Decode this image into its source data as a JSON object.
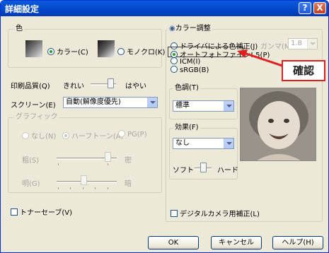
{
  "window": {
    "title": "詳細設定",
    "help_glyph": "?",
    "close_glyph": "X"
  },
  "color": {
    "group_label": "色",
    "option_color": "カラー(C)",
    "option_mono": "モノクロ(K)",
    "selected": "color"
  },
  "print_quality": {
    "label": "印刷品質(Q)",
    "left_label": "きれい",
    "right_label": "はやい"
  },
  "screen": {
    "label": "スクリーン(E)",
    "value": "自動(解像度優先)"
  },
  "graphic": {
    "group_label": "グラフィック",
    "options": [
      "なし(N)",
      "ハーフトーン(A)",
      "PG(P)"
    ],
    "selected": "ハーフトーン(A)",
    "coarse_label": "粗(S)",
    "coarse_right": "密",
    "bright_label": "明(G)",
    "bright_right": "暗"
  },
  "toner_save": {
    "label": "トナーセーブ(V)",
    "checked": false
  },
  "color_adjust": {
    "group_label": "カラー調整",
    "options": [
      "ドライバによる色補正(J)",
      "オートフォトファイン! 5(P)",
      "ICM(I)",
      "sRGB(B)"
    ],
    "selected": "オートフォトファイン! 5(P)",
    "gamma_label": "ガンマ(M)",
    "gamma_value": "1.8"
  },
  "tone": {
    "label": "色調(T)",
    "value": "標準"
  },
  "effect": {
    "label": "効果(F)",
    "value": "なし",
    "soft_label": "ソフト",
    "hard_label": "ハード"
  },
  "digital_camera": {
    "label": "デジタルカメラ用補正(L)",
    "checked": false
  },
  "buttons": {
    "ok": "OK",
    "cancel": "キャンセル",
    "help": "ヘルプ(H)"
  },
  "annotation": {
    "callout_text": "確認",
    "accent_color": "#e02020"
  }
}
